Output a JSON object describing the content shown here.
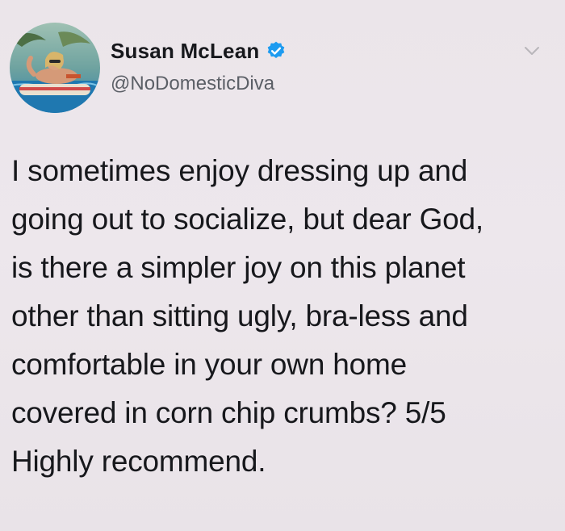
{
  "tweet": {
    "author": {
      "display_name": "Susan McLean",
      "handle": "@NoDomesticDiva",
      "verified": true,
      "verified_color": "#1d9bf0",
      "avatar_icon": "profile-photo-woman-on-pool-float"
    },
    "more_icon": "chevron-down-icon",
    "text": "I sometimes enjoy dressing up and\ngoing out to socialize, but dear God,\nis there a simpler joy on this planet\nother than sitting ugly, bra-less and\ncomfortable in your own home\ncovered in corn chip crumbs? 5/5\nHighly recommend."
  }
}
